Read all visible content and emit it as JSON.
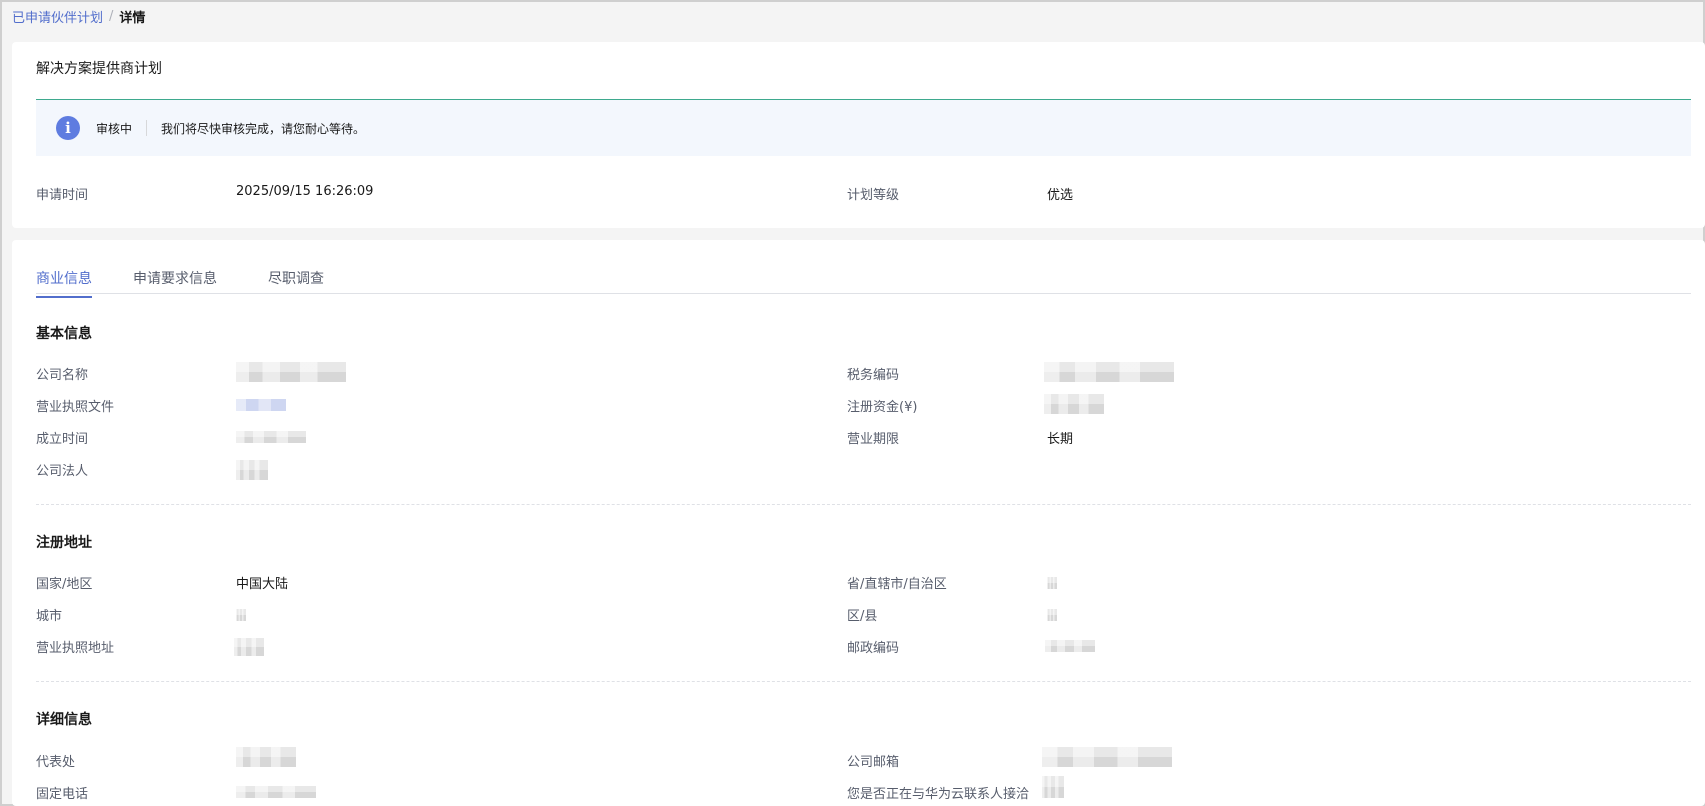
{
  "breadcrumb": {
    "parent": "已申请伙伴计划",
    "separator": "/",
    "current": "详情"
  },
  "plan": {
    "title": "解决方案提供商计划",
    "status_label": "审核中",
    "status_message": "我们将尽快审核完成，请您耐心等待。",
    "apply_time_label": "申请时间",
    "apply_time_value": "2025/09/15 16:26:09",
    "level_label": "计划等级",
    "level_value": "优选"
  },
  "tabs": [
    "商业信息",
    "申请要求信息",
    "尽职调查"
  ],
  "sections": {
    "basic": {
      "title": "基本信息",
      "company_name_label": "公司名称",
      "tax_code_label": "税务编码",
      "license_file_label": "营业执照文件",
      "reg_capital_label": "注册资金(¥)",
      "founded_label": "成立时间",
      "business_term_label": "营业期限",
      "business_term_value": "长期",
      "legal_person_label": "公司法人"
    },
    "address": {
      "title": "注册地址",
      "country_label": "国家/地区",
      "country_value": "中国大陆",
      "province_label": "省/直辖市/自治区",
      "city_label": "城市",
      "district_label": "区/县",
      "license_address_label": "营业执照地址",
      "postal_label": "邮政编码"
    },
    "detail": {
      "title": "详细信息",
      "office_label": "代表处",
      "email_label": "公司邮箱",
      "phone_label": "固定电话",
      "contact_label": "您是否正在与华为云联系人接洽"
    }
  },
  "colors": {
    "accent": "#526ecc",
    "status_border": "#3ea98e",
    "info_icon": "#5e7ce0"
  }
}
